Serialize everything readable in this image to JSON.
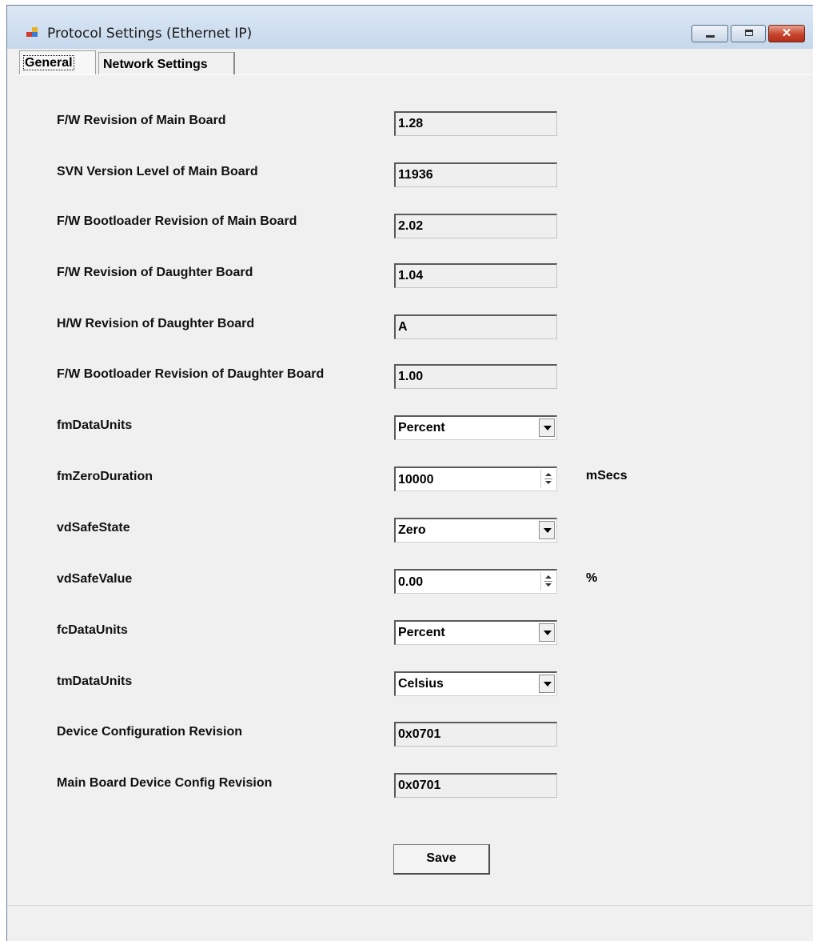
{
  "window": {
    "title": "Protocol Settings (Ethernet IP)",
    "close_glyph": "✕"
  },
  "tabs": [
    {
      "label": "General"
    },
    {
      "label": "Network Settings"
    }
  ],
  "fields": {
    "fw_main": {
      "label": "F/W Revision of Main Board",
      "value": "1.28"
    },
    "svn_main": {
      "label": "SVN Version Level of Main Board",
      "value": "11936"
    },
    "fw_boot_main": {
      "label": "F/W Bootloader Revision of Main Board",
      "value": "2.02"
    },
    "fw_daughter": {
      "label": "F/W Revision of Daughter Board",
      "value": "1.04"
    },
    "hw_daughter": {
      "label": "H/W Revision of Daughter Board",
      "value": "A"
    },
    "fw_boot_daughter": {
      "label": "F/W Bootloader Revision of Daughter Board",
      "value": "1.00"
    },
    "fm_data_units": {
      "label": "fmDataUnits",
      "value": "Percent"
    },
    "fm_zero_duration": {
      "label": "fmZeroDuration",
      "value": "10000",
      "unit": "mSecs"
    },
    "vd_safe_state": {
      "label": "vdSafeState",
      "value": "Zero"
    },
    "vd_safe_value": {
      "label": "vdSafeValue",
      "value": "0.00",
      "unit": "%"
    },
    "fc_data_units": {
      "label": "fcDataUnits",
      "value": "Percent"
    },
    "tm_data_units": {
      "label": "tmDataUnits",
      "value": "Celsius"
    },
    "device_config_rev": {
      "label": "Device Configuration Revision",
      "value": "0x0701"
    },
    "main_board_config_rev": {
      "label": "Main Board Device Config Revision",
      "value": "0x0701"
    }
  },
  "buttons": {
    "save": "Save"
  },
  "icons": {
    "app": "app-icon",
    "minimize": "minimize-icon",
    "maximize": "maximize-icon",
    "close": "close-icon"
  }
}
